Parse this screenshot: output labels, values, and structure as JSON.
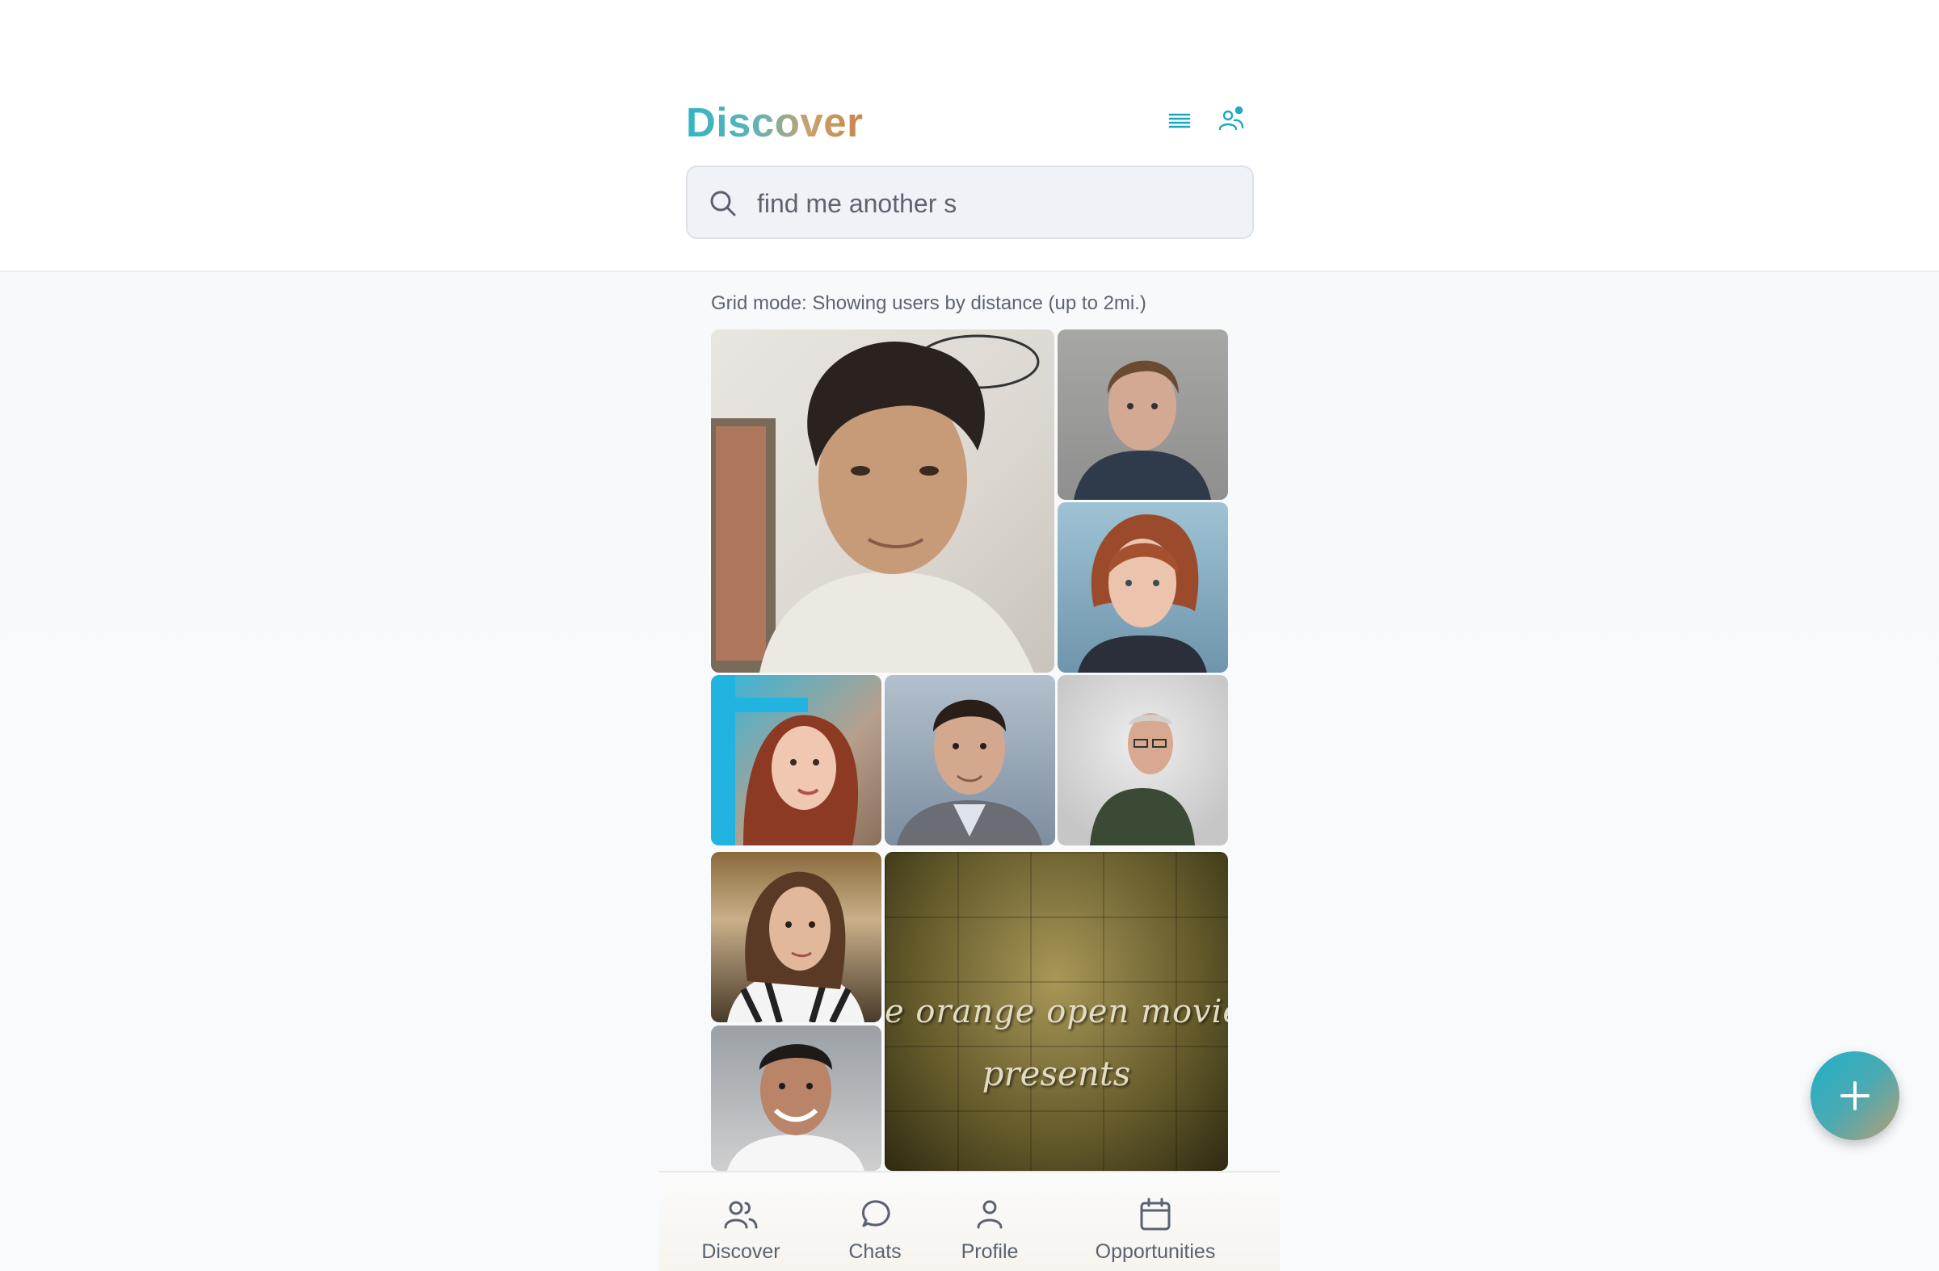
{
  "header": {
    "title": "Discover",
    "list_view_icon": "list-view-icon",
    "people_settings_icon": "people-settings-icon"
  },
  "search": {
    "value": "find me another s",
    "icon": "search-icon"
  },
  "grid": {
    "mode_text": "Grid mode: Showing users by distance (up to 2mi.)",
    "tiles": [
      {
        "kind": "profile-photo",
        "size": "large"
      },
      {
        "kind": "profile-photo",
        "size": "small"
      },
      {
        "kind": "profile-photo",
        "size": "small"
      },
      {
        "kind": "profile-photo",
        "size": "small"
      },
      {
        "kind": "profile-photo",
        "size": "small"
      },
      {
        "kind": "profile-photo",
        "size": "small"
      },
      {
        "kind": "profile-photo",
        "size": "small"
      },
      {
        "kind": "video-frame",
        "size": "large",
        "line1": "e orange open movie projec",
        "line2": "presents"
      },
      {
        "kind": "profile-photo",
        "size": "small"
      }
    ]
  },
  "nav": {
    "items": [
      {
        "label": "Discover",
        "icon": "users-icon"
      },
      {
        "label": "Chats",
        "icon": "chat-bubble-icon"
      },
      {
        "label": "Profile",
        "icon": "user-icon"
      },
      {
        "label": "Opportunities",
        "icon": "calendar-icon"
      }
    ]
  },
  "fab": {
    "icon": "plus-icon"
  },
  "colors": {
    "accent": "#1fb1c8",
    "title_gradient_start": "#31b4c4",
    "title_gradient_end": "#c8864a",
    "nav_text": "#5a6170"
  }
}
